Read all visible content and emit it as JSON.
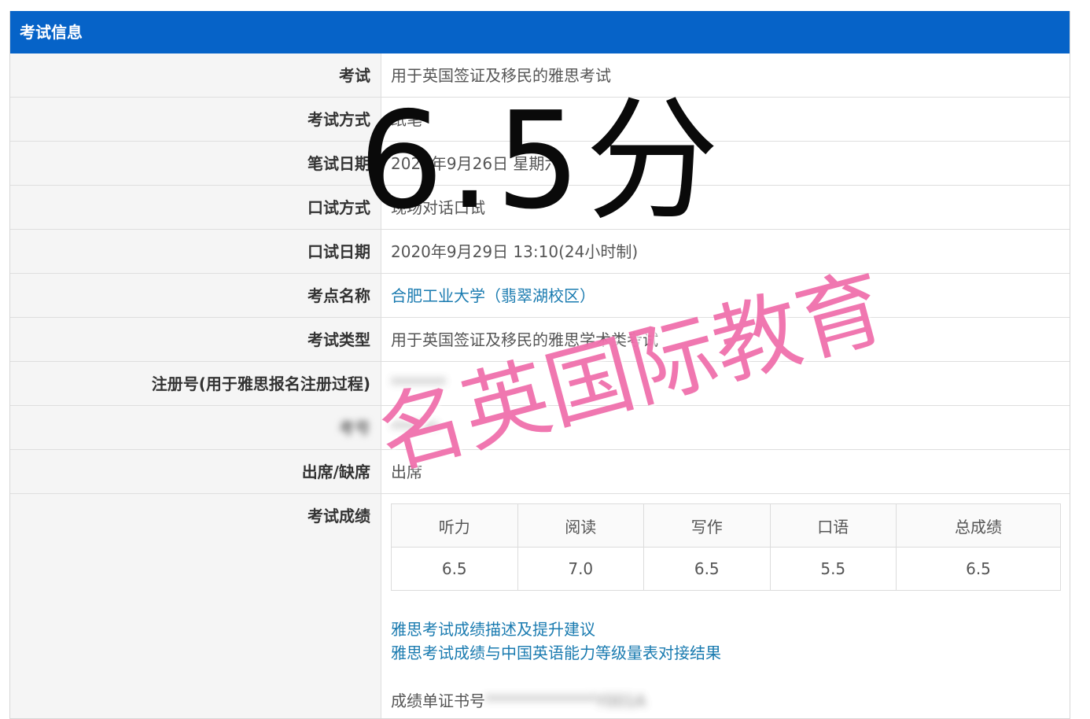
{
  "panel": {
    "title": "考试信息"
  },
  "rows": [
    {
      "label": "考试",
      "value": "用于英国签证及移民的雅思考试"
    },
    {
      "label": "考试方式",
      "value": "纸笔"
    },
    {
      "label": "笔试日期",
      "value": "2020年9月26日 星期六"
    },
    {
      "label": "口试方式",
      "value": "现场对话口试"
    },
    {
      "label": "口试日期",
      "value": "2020年9月29日 13:10(24小时制)"
    },
    {
      "label": "考点名称",
      "value": "合肥工业大学（翡翠湖校区）"
    },
    {
      "label": "考试类型",
      "value": "用于英国签证及移民的雅思学术类考试"
    },
    {
      "label": "注册号(用于雅思报名注册过程)",
      "value": "*******"
    },
    {
      "label": "考号",
      "value": "******"
    },
    {
      "label": "出席/缺席",
      "value": "出席"
    }
  ],
  "scores": {
    "label": "考试成绩",
    "headers": [
      "听力",
      "阅读",
      "写作",
      "口语",
      "总成绩"
    ],
    "values": [
      "6.5",
      "7.0",
      "6.5",
      "5.5",
      "6.5"
    ]
  },
  "links": {
    "description": "雅思考试成绩描述及提升建议",
    "mapping": "雅思考试成绩与中国英语能力等级量表对接结果"
  },
  "certificate": {
    "label": "成绩单证书号",
    "value": "**************Y001A"
  },
  "overlay": {
    "score_text": "6.5分",
    "watermark_text": "名英国际教育"
  },
  "colors": {
    "header_bg": "#0663c8",
    "link": "#1a7bb0",
    "watermark": "#ee64a5"
  }
}
